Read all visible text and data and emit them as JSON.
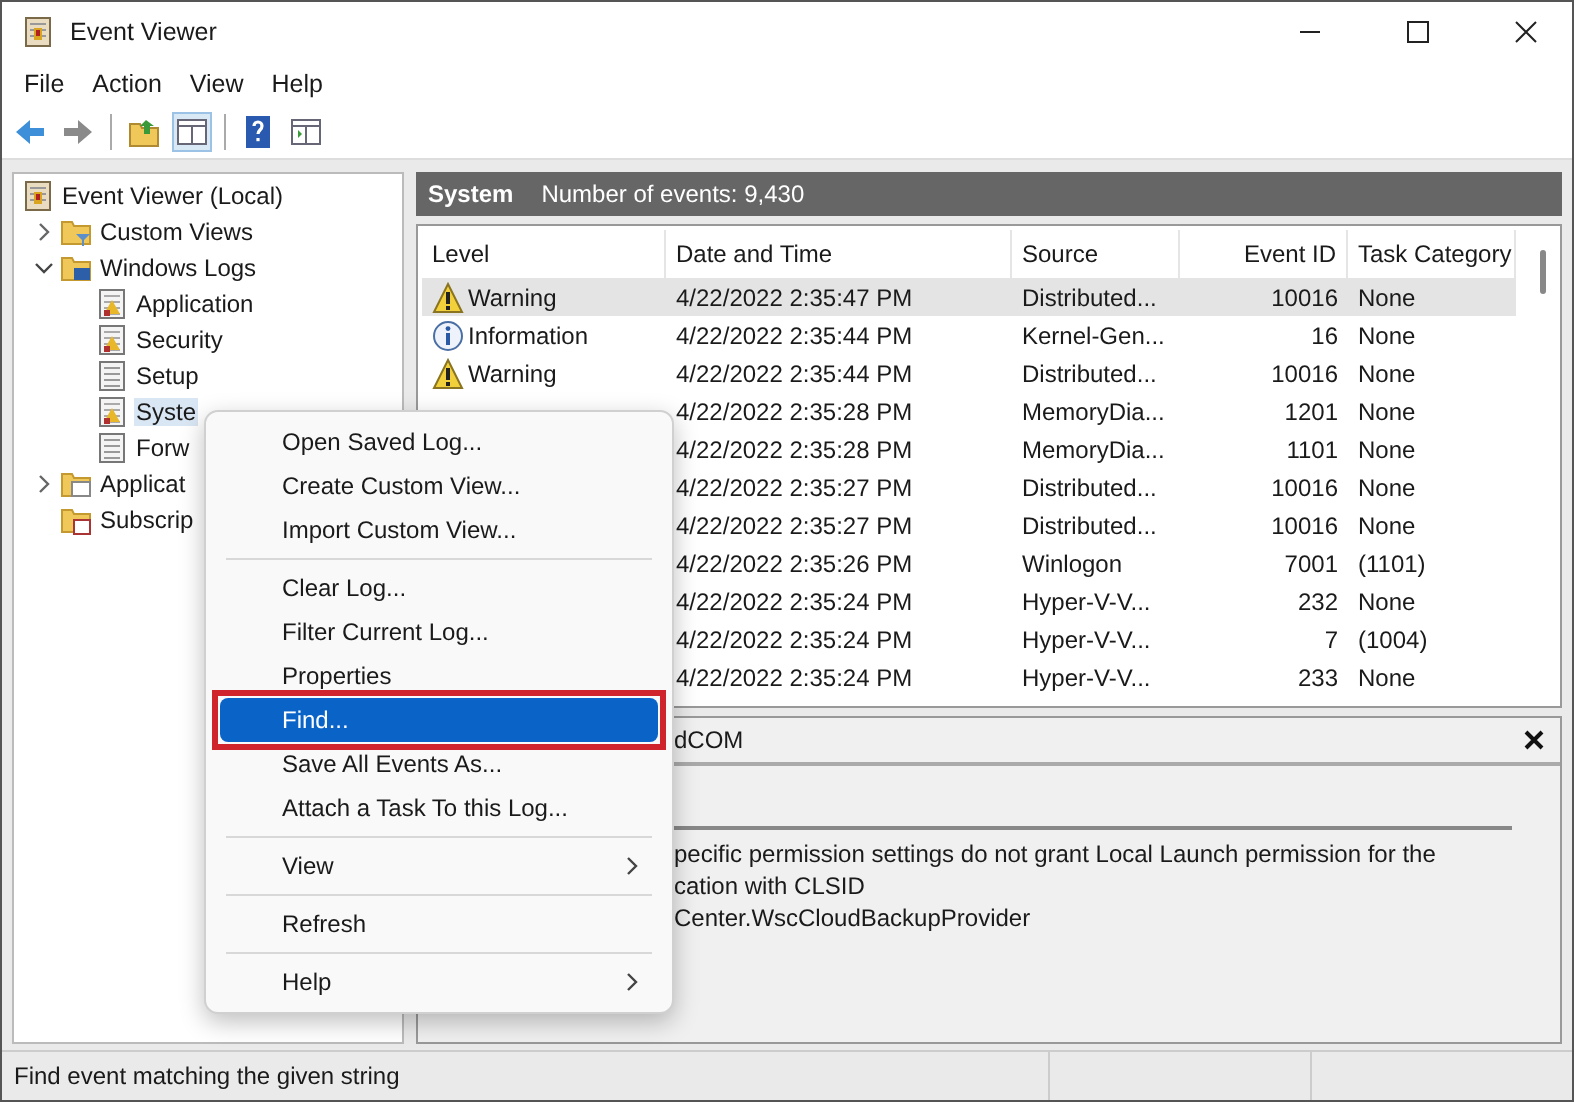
{
  "window": {
    "title": "Event Viewer"
  },
  "menu_bar": [
    "File",
    "Action",
    "View",
    "Help"
  ],
  "tree": [
    {
      "label": "Event Viewer (Local)",
      "kind": "viewer",
      "selected": false,
      "children": [
        {
          "label": "Custom Views",
          "kind": "filter",
          "expanded": false,
          "selected": false
        },
        {
          "label": "Windows Logs",
          "kind": "computer",
          "expanded": true,
          "selected": false,
          "children": [
            {
              "label": "Application",
              "kind": "log",
              "selected": false
            },
            {
              "label": "Security",
              "kind": "log",
              "selected": false
            },
            {
              "label": "Setup",
              "kind": "plain",
              "selected": false
            },
            {
              "label": "Syste",
              "kind": "log",
              "selected": true
            },
            {
              "label": "Forw",
              "kind": "plain",
              "selected": false
            }
          ]
        },
        {
          "label": "Applicat",
          "kind": "folder",
          "expanded": false,
          "selected": false
        },
        {
          "label": "Subscrip",
          "kind": "subscription",
          "selected": false
        }
      ]
    }
  ],
  "log_header": {
    "name": "System",
    "count": "Number of events: 9,430"
  },
  "table": {
    "columns": [
      "Level",
      "Date and Time",
      "Source",
      "Event ID",
      "Task Category"
    ],
    "rows": [
      {
        "level": "Warning",
        "kind": "warning",
        "date": "4/22/2022 2:35:47 PM",
        "source": "Distributed...",
        "event_id": "10016",
        "task_category": "None",
        "selected": true
      },
      {
        "level": "Information",
        "kind": "information",
        "date": "4/22/2022 2:35:44 PM",
        "source": "Kernel-Gen...",
        "event_id": "16",
        "task_category": "None",
        "selected": false
      },
      {
        "level": "Warning",
        "kind": "warning",
        "date": "4/22/2022 2:35:44 PM",
        "source": "Distributed...",
        "event_id": "10016",
        "task_category": "None",
        "selected": false
      },
      {
        "date": "4/22/2022 2:35:28 PM",
        "source": "MemoryDia...",
        "event_id": "1201",
        "task_category": "None",
        "selected": false
      },
      {
        "date": "4/22/2022 2:35:28 PM",
        "source": "MemoryDia...",
        "event_id": "1101",
        "task_category": "None",
        "selected": false
      },
      {
        "date": "4/22/2022 2:35:27 PM",
        "source": "Distributed...",
        "event_id": "10016",
        "task_category": "None",
        "selected": false
      },
      {
        "date": "4/22/2022 2:35:27 PM",
        "source": "Distributed...",
        "event_id": "10016",
        "task_category": "None",
        "selected": false
      },
      {
        "date": "4/22/2022 2:35:26 PM",
        "source": "Winlogon",
        "event_id": "7001",
        "task_category": "(1101)",
        "selected": false
      },
      {
        "date": "4/22/2022 2:35:24 PM",
        "source": "Hyper-V-V...",
        "event_id": "232",
        "task_category": "None",
        "selected": false
      },
      {
        "date": "4/22/2022 2:35:24 PM",
        "source": "Hyper-V-V...",
        "event_id": "7",
        "task_category": "(1004)",
        "selected": false
      },
      {
        "date": "4/22/2022 2:35:24 PM",
        "source": "Hyper-V-V...",
        "event_id": "233",
        "task_category": "None",
        "selected": false
      }
    ]
  },
  "details": {
    "title": "dCOM",
    "lines": [
      "pecific permission settings do not grant Local Launch permission for the",
      "cation with CLSID",
      "Center.WscCloudBackupProvider"
    ]
  },
  "context_menu": {
    "groups": [
      [
        {
          "label": "Open Saved Log...",
          "selected": false,
          "submenu": false
        },
        {
          "label": "Create Custom View...",
          "selected": false,
          "submenu": false
        },
        {
          "label": "Import Custom View...",
          "selected": false,
          "submenu": false
        }
      ],
      [
        {
          "label": "Clear Log...",
          "selected": false,
          "submenu": false
        },
        {
          "label": "Filter Current Log...",
          "selected": false,
          "submenu": false
        },
        {
          "label": "Properties",
          "selected": false,
          "submenu": false
        },
        {
          "label": "Find...",
          "selected": true,
          "submenu": false
        },
        {
          "label": "Save All Events As...",
          "selected": false,
          "submenu": false
        },
        {
          "label": "Attach a Task To this Log...",
          "selected": false,
          "submenu": false
        }
      ],
      [
        {
          "label": "View",
          "selected": false,
          "submenu": true
        }
      ],
      [
        {
          "label": "Refresh",
          "selected": false,
          "submenu": false
        }
      ],
      [
        {
          "label": "Help",
          "selected": false,
          "submenu": true
        }
      ]
    ]
  },
  "status_bar": "Find event matching the given string"
}
